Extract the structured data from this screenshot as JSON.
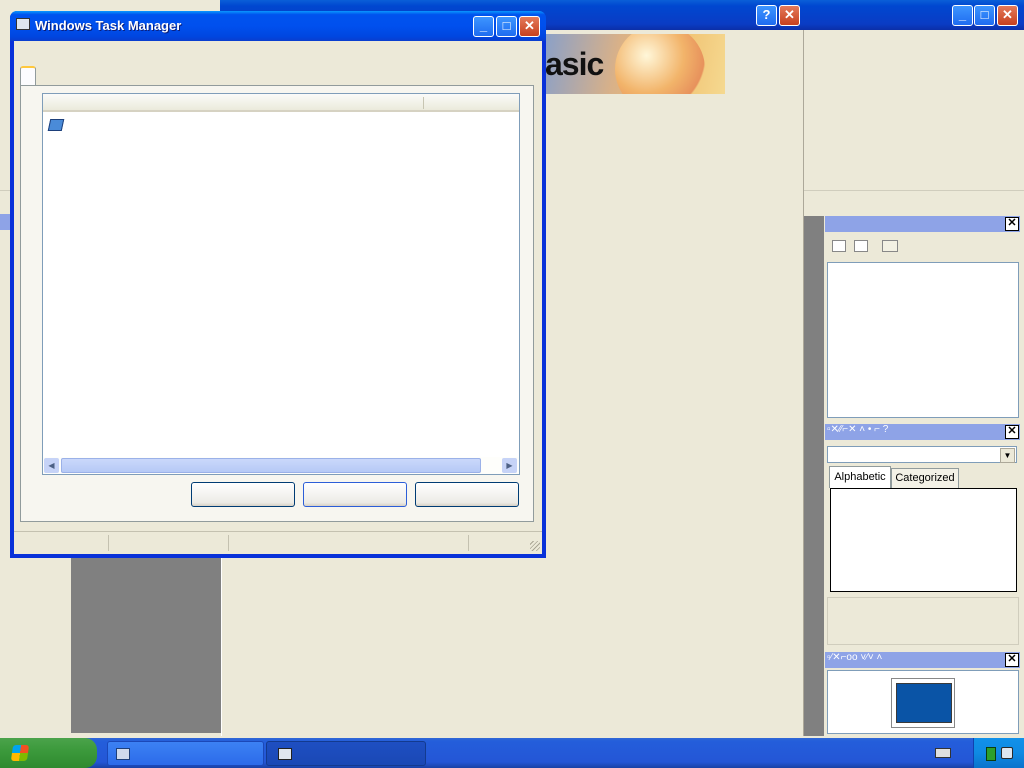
{
  "task_manager": {
    "title": "Windows Task Manager",
    "properties": {
      "tabs": [
        "Alphabetic",
        "Categorized"
      ]
    }
  },
  "ide": {
    "banner_text": "asic"
  },
  "colors": {
    "desktop_face": "#ece9d8",
    "title_blue": "#0053ee",
    "taskbar_blue": "#245edb",
    "start_green": "#3c9a3c",
    "panel_header": "#8ea3e7"
  }
}
